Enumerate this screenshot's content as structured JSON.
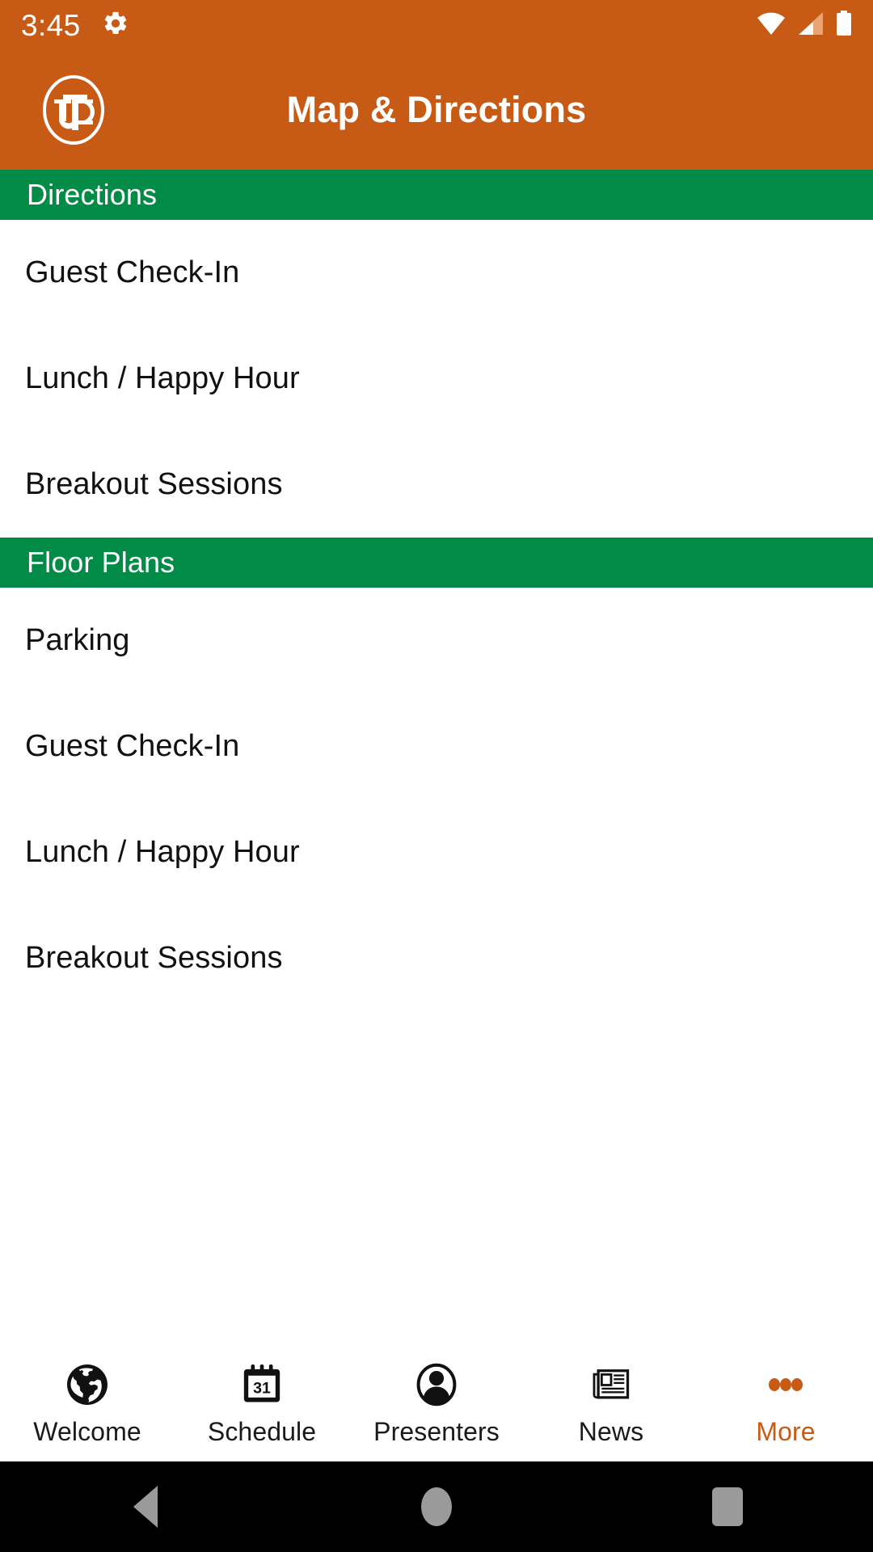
{
  "status_bar": {
    "time": "3:45",
    "icons": [
      "gear-icon",
      "wifi-icon",
      "cellular-signal-icon",
      "battery-icon"
    ]
  },
  "app_bar": {
    "title": "Map & Directions",
    "logo_text": "UTD",
    "background_color": "#C75B16",
    "title_color": "#FFFFFF"
  },
  "theme": {
    "primary_orange": "#C75B16",
    "section_green": "#018B46",
    "page_background": "#FFFFFF",
    "body_text": "#111111",
    "active_tab_color": "#C75B16",
    "android_nav_background": "#000000",
    "android_nav_icon": "#9A9A9A"
  },
  "sections": [
    {
      "header": "Directions",
      "items": [
        {
          "label": "Guest Check-In"
        },
        {
          "label": "Lunch / Happy Hour"
        },
        {
          "label": "Breakout Sessions"
        }
      ]
    },
    {
      "header": "Floor Plans",
      "items": [
        {
          "label": "Parking"
        },
        {
          "label": "Guest Check-In"
        },
        {
          "label": "Lunch / Happy Hour"
        },
        {
          "label": "Breakout Sessions"
        }
      ]
    }
  ],
  "tab_bar": {
    "tabs": [
      {
        "label": "Welcome",
        "icon": "globe-icon",
        "active": false
      },
      {
        "label": "Schedule",
        "icon": "calendar-icon",
        "active": false,
        "icon_day": "31"
      },
      {
        "label": "Presenters",
        "icon": "person-icon",
        "active": false
      },
      {
        "label": "News",
        "icon": "newspaper-icon",
        "active": false
      },
      {
        "label": "More",
        "icon": "more-dots-icon",
        "active": true
      }
    ]
  },
  "android_nav": {
    "buttons": [
      {
        "name": "back-button"
      },
      {
        "name": "home-button"
      },
      {
        "name": "recents-button"
      }
    ]
  }
}
